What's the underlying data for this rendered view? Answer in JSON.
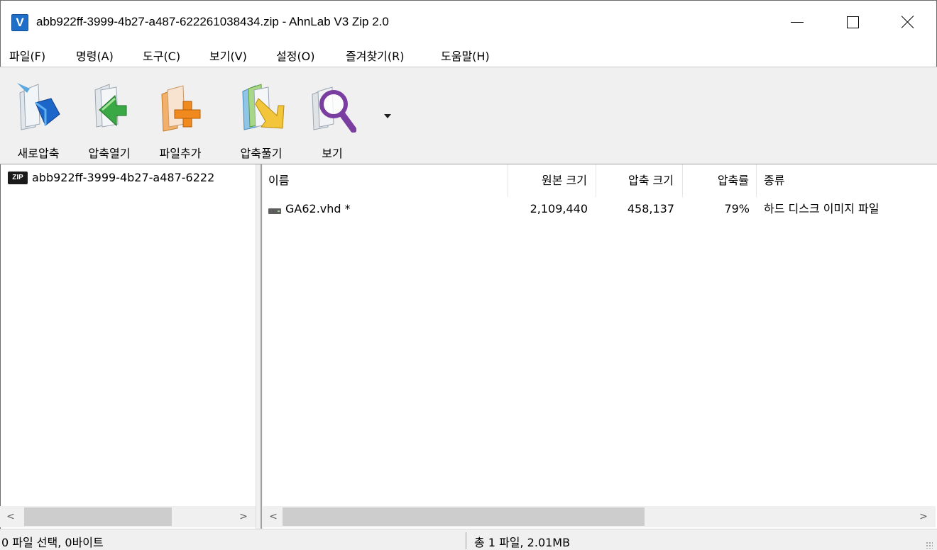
{
  "window": {
    "title": "abb922ff-3999-4b27-a487-622261038434.zip - AhnLab V3 Zip 2.0",
    "app_icon_letter": "V",
    "accent_color": "#1f6fc9"
  },
  "menu": [
    "파일(F)",
    "명령(A)",
    "도구(C)",
    "보기(V)",
    "설정(O)",
    "즐겨찾기(R)",
    "도움말(H)"
  ],
  "toolbar": {
    "buttons": [
      {
        "label": "새로압축",
        "icon": "new-compress-icon"
      },
      {
        "label": "압축열기",
        "icon": "open-archive-icon"
      },
      {
        "label": "파일추가",
        "icon": "add-file-icon"
      },
      {
        "label": "압축풀기",
        "icon": "extract-icon"
      },
      {
        "label": "보기",
        "icon": "view-icon"
      }
    ]
  },
  "tree": {
    "root_label": "abb922ff-3999-4b27-a487-6222",
    "zip_badge": "ZIP"
  },
  "list": {
    "headers": [
      "이름",
      "원본 크기",
      "압축 크기",
      "압축률",
      "종류"
    ],
    "rows": [
      {
        "name": "GA62.vhd *",
        "original_size": "2,109,440",
        "compressed_size": "458,137",
        "ratio": "79%",
        "type": "하드 디스크 이미지 파일"
      }
    ]
  },
  "status": {
    "selection": "0 파일 선택, 0바이트",
    "total": "총 1 파일, 2.01MB"
  },
  "scroll": {
    "left_arrow": "<",
    "right_arrow": ">"
  }
}
